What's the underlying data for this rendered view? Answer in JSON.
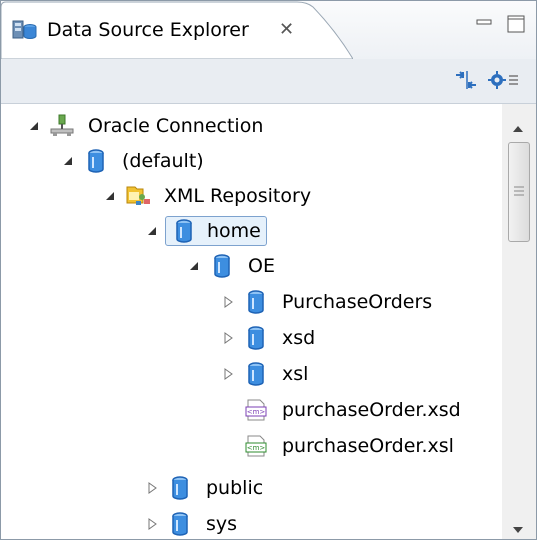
{
  "view": {
    "title": "Data Source Explorer",
    "close_glyph": "✕"
  },
  "icons": {
    "view_icon": "data-source-explorer-icon",
    "minimize": "minimize-icon",
    "maximize": "maximize-icon",
    "collapse_all": "collapse-all-icon",
    "view_menu": "view-menu-icon"
  },
  "tree": {
    "items": [
      {
        "label": "Oracle Connection",
        "expanded": true,
        "icon": "connection-icon"
      },
      {
        "label": "(default)",
        "expanded": true,
        "icon": "database-icon"
      },
      {
        "label": "XML Repository",
        "expanded": true,
        "icon": "xml-repository-icon"
      },
      {
        "label": "home",
        "expanded": true,
        "icon": "folder-db-icon",
        "selected": true
      },
      {
        "label": "OE",
        "expanded": true,
        "icon": "folder-db-icon"
      },
      {
        "label": "PurchaseOrders",
        "expanded": false,
        "icon": "folder-db-icon"
      },
      {
        "label": "xsd",
        "expanded": false,
        "icon": "folder-db-icon"
      },
      {
        "label": "xsl",
        "expanded": false,
        "icon": "folder-db-icon"
      },
      {
        "label": "purchaseOrder.xsd",
        "icon": "xsd-file-icon"
      },
      {
        "label": "purchaseOrder.xsl",
        "icon": "xsl-file-icon"
      },
      {
        "label": "public",
        "expanded": false,
        "icon": "folder-db-icon"
      },
      {
        "label": "sys",
        "expanded": false,
        "icon": "folder-db-icon"
      }
    ]
  },
  "colors": {
    "db_blue": "#2f7fd6",
    "selection_bg": "#e6f1fb",
    "selection_border": "#7da2ce"
  }
}
